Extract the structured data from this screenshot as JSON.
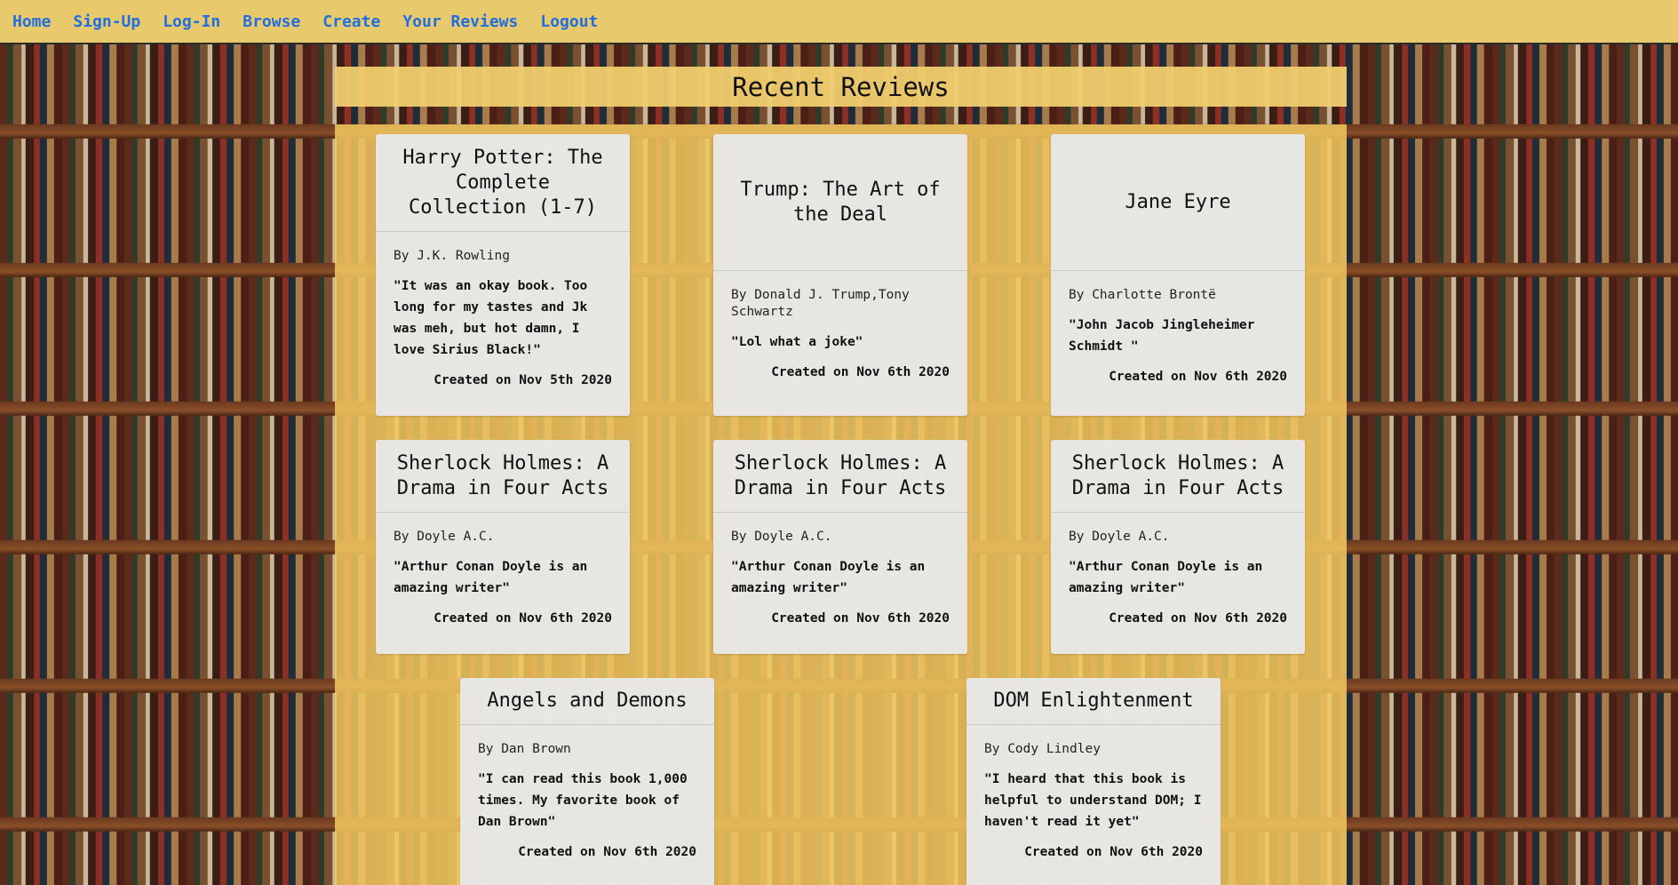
{
  "nav": {
    "links": [
      "Home",
      "Sign-Up",
      "Log-In",
      "Browse",
      "Create",
      "Your Reviews",
      "Logout"
    ]
  },
  "page_title": "Recent Reviews",
  "reviews": [
    {
      "title": "Harry Potter: The Complete Collection (1-7)",
      "author": "By J.K. Rowling",
      "review": "\"It was an okay book. Too long for my tastes and Jk was meh, but hot damn, I love Sirius Black!\"",
      "date": "Created on Nov 5th 2020"
    },
    {
      "title": "Trump: The Art of the Deal",
      "author": "By Donald J. Trump,Tony Schwartz",
      "review": "\"Lol what a joke\"",
      "date": "Created on Nov 6th 2020"
    },
    {
      "title": "Jane Eyre",
      "author": "By Charlotte Brontë",
      "review": "\"John Jacob Jingleheimer Schmidt \"",
      "date": "Created on Nov 6th 2020"
    },
    {
      "title": "Sherlock Holmes: A Drama in Four Acts",
      "author": "By Doyle A.C.",
      "review": "\"Arthur Conan Doyle is an amazing writer\"",
      "date": "Created on Nov 6th 2020"
    },
    {
      "title": "Sherlock Holmes: A Drama in Four Acts",
      "author": "By Doyle A.C.",
      "review": "\"Arthur Conan Doyle is an amazing writer\"",
      "date": "Created on Nov 6th 2020"
    },
    {
      "title": "Sherlock Holmes: A Drama in Four Acts",
      "author": "By Doyle A.C.",
      "review": "\"Arthur Conan Doyle is an amazing writer\"",
      "date": "Created on Nov 6th 2020"
    },
    {
      "title": "Angels and Demons",
      "author": "By Dan Brown",
      "review": "\"I can read this book 1,000 times. My favorite book of Dan Brown\"",
      "date": "Created on Nov 6th 2020"
    },
    {
      "title": "DOM Enlightenment",
      "author": "By Cody Lindley",
      "review": "\"I heard that this book is helpful to understand DOM; I haven't read it yet\"",
      "date": "Created on Nov 6th 2020"
    }
  ]
}
